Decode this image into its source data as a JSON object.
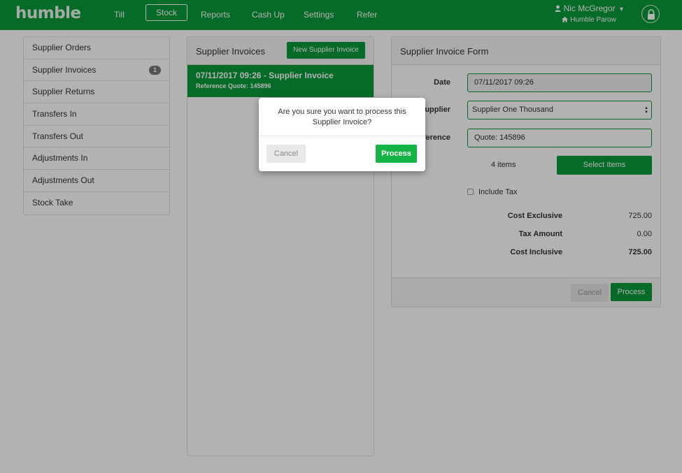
{
  "app": {
    "logo": "humble"
  },
  "nav": {
    "items": [
      "Till",
      "Stock",
      "Reports",
      "Cash Up",
      "Settings",
      "Refer"
    ],
    "active": "Stock"
  },
  "user": {
    "name": "Nic McGregor",
    "store": "Humble Parow",
    "dropdown_glyph": "▾"
  },
  "sidebar": {
    "items": [
      {
        "label": "Supplier Orders"
      },
      {
        "label": "Supplier Invoices",
        "badge": "1"
      },
      {
        "label": "Supplier Returns"
      },
      {
        "label": "Transfers In"
      },
      {
        "label": "Transfers Out"
      },
      {
        "label": "Adjustments In"
      },
      {
        "label": "Adjustments Out"
      },
      {
        "label": "Stock Take"
      }
    ]
  },
  "invoices": {
    "title": "Supplier Invoices",
    "new_button": "New Supplier Invoice",
    "items": [
      {
        "title": "07/11/2017 09:26 - Supplier Invoice",
        "subtitle": "Reference Quote: 145896"
      }
    ]
  },
  "form": {
    "title": "Supplier Invoice Form",
    "date_label": "Date",
    "date_value": "07/11/2017 09:26",
    "supplier_label": "Supplier",
    "supplier_value": "Supplier One Thousand",
    "reference_label": "Reference",
    "reference_value": "Quote: 145896",
    "items_count": "4 items",
    "select_items": "Select Items",
    "include_tax": "Include Tax",
    "cost_exclusive_label": "Cost Exclusive",
    "cost_exclusive": "725.00",
    "tax_amount_label": "Tax Amount",
    "tax_amount": "0.00",
    "cost_inclusive_label": "Cost Inclusive",
    "cost_inclusive": "725.00",
    "cancel": "Cancel",
    "process": "Process"
  },
  "dialog": {
    "message": "Are you sure you want to process this Supplier Invoice?",
    "cancel": "Cancel",
    "process": "Process"
  },
  "colors": {
    "brand_green": "#0a9a3a",
    "dialog_green": "#14b544"
  }
}
